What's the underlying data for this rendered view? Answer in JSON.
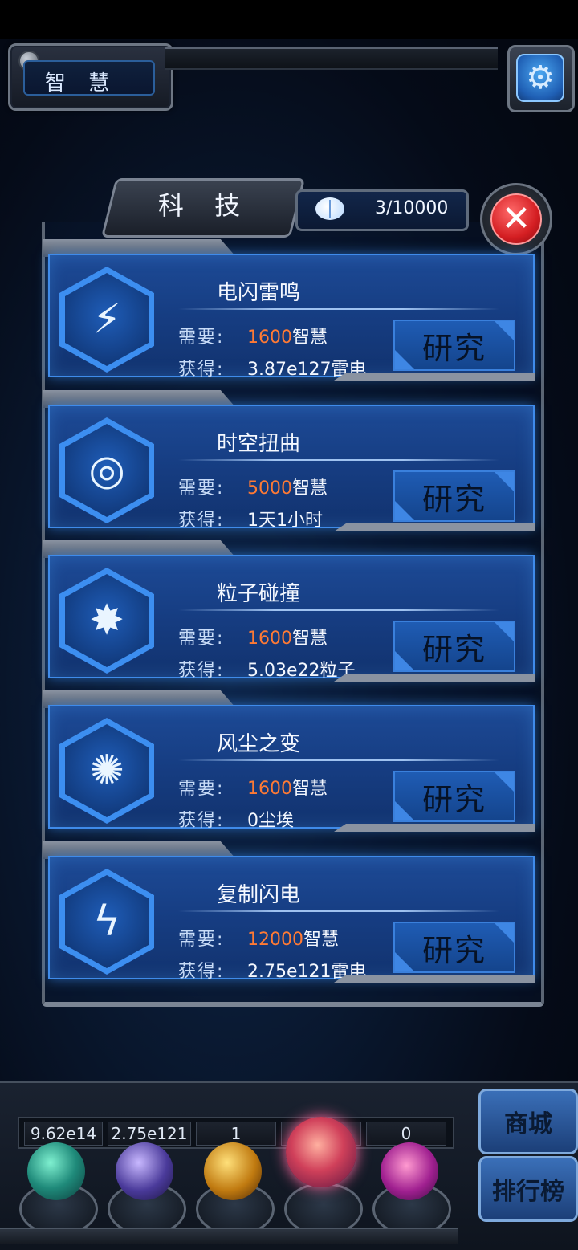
{
  "header": {
    "wisdom_label": "智 慧",
    "settings_icon": "gear-icon"
  },
  "panel": {
    "title": "科 技",
    "wisdom_count": "3/10000",
    "close_icon": "close-icon"
  },
  "colors": {
    "cost": "#ff7a34",
    "card": "#1d4a96",
    "border": "#3f8bea"
  },
  "cards": [
    {
      "name": "电闪雷鸣",
      "need_label": "需要:",
      "cost": "1600",
      "cost_unit": "智慧",
      "gain_label": "获得:",
      "gain": "3.87e127雷电",
      "button": "研究",
      "icon": "lightning-burst-icon",
      "glyph": "⚡"
    },
    {
      "name": "时空扭曲",
      "need_label": "需要:",
      "cost": "5000",
      "cost_unit": "智慧",
      "gain_label": "获得:",
      "gain": "1天1小时",
      "button": "研究",
      "icon": "vortex-icon",
      "glyph": "◎"
    },
    {
      "name": "粒子碰撞",
      "need_label": "需要:",
      "cost": "1600",
      "cost_unit": "智慧",
      "gain_label": "获得:",
      "gain": "5.03e22粒子",
      "button": "研究",
      "icon": "particle-collision-icon",
      "glyph": "✸"
    },
    {
      "name": "风尘之变",
      "need_label": "需要:",
      "cost": "1600",
      "cost_unit": "智慧",
      "gain_label": "获得:",
      "gain": "0尘埃",
      "button": "研究",
      "icon": "dust-explosion-icon",
      "glyph": "✺"
    },
    {
      "name": "复制闪电",
      "need_label": "需要:",
      "cost": "12000",
      "cost_unit": "智慧",
      "gain_label": "获得:",
      "gain": "2.75e121雷电",
      "button": "研究",
      "icon": "copy-lightning-icon",
      "glyph": "ϟ"
    }
  ],
  "hud": {
    "counters": [
      "9.62e14",
      "2.75e121",
      "1",
      "",
      "0"
    ],
    "orbs": [
      "green-atom-orb",
      "lightning-orb",
      "fire-orb",
      "particle-orb",
      "vortex-orb"
    ],
    "shop": "商城",
    "ranking": "排行榜"
  }
}
